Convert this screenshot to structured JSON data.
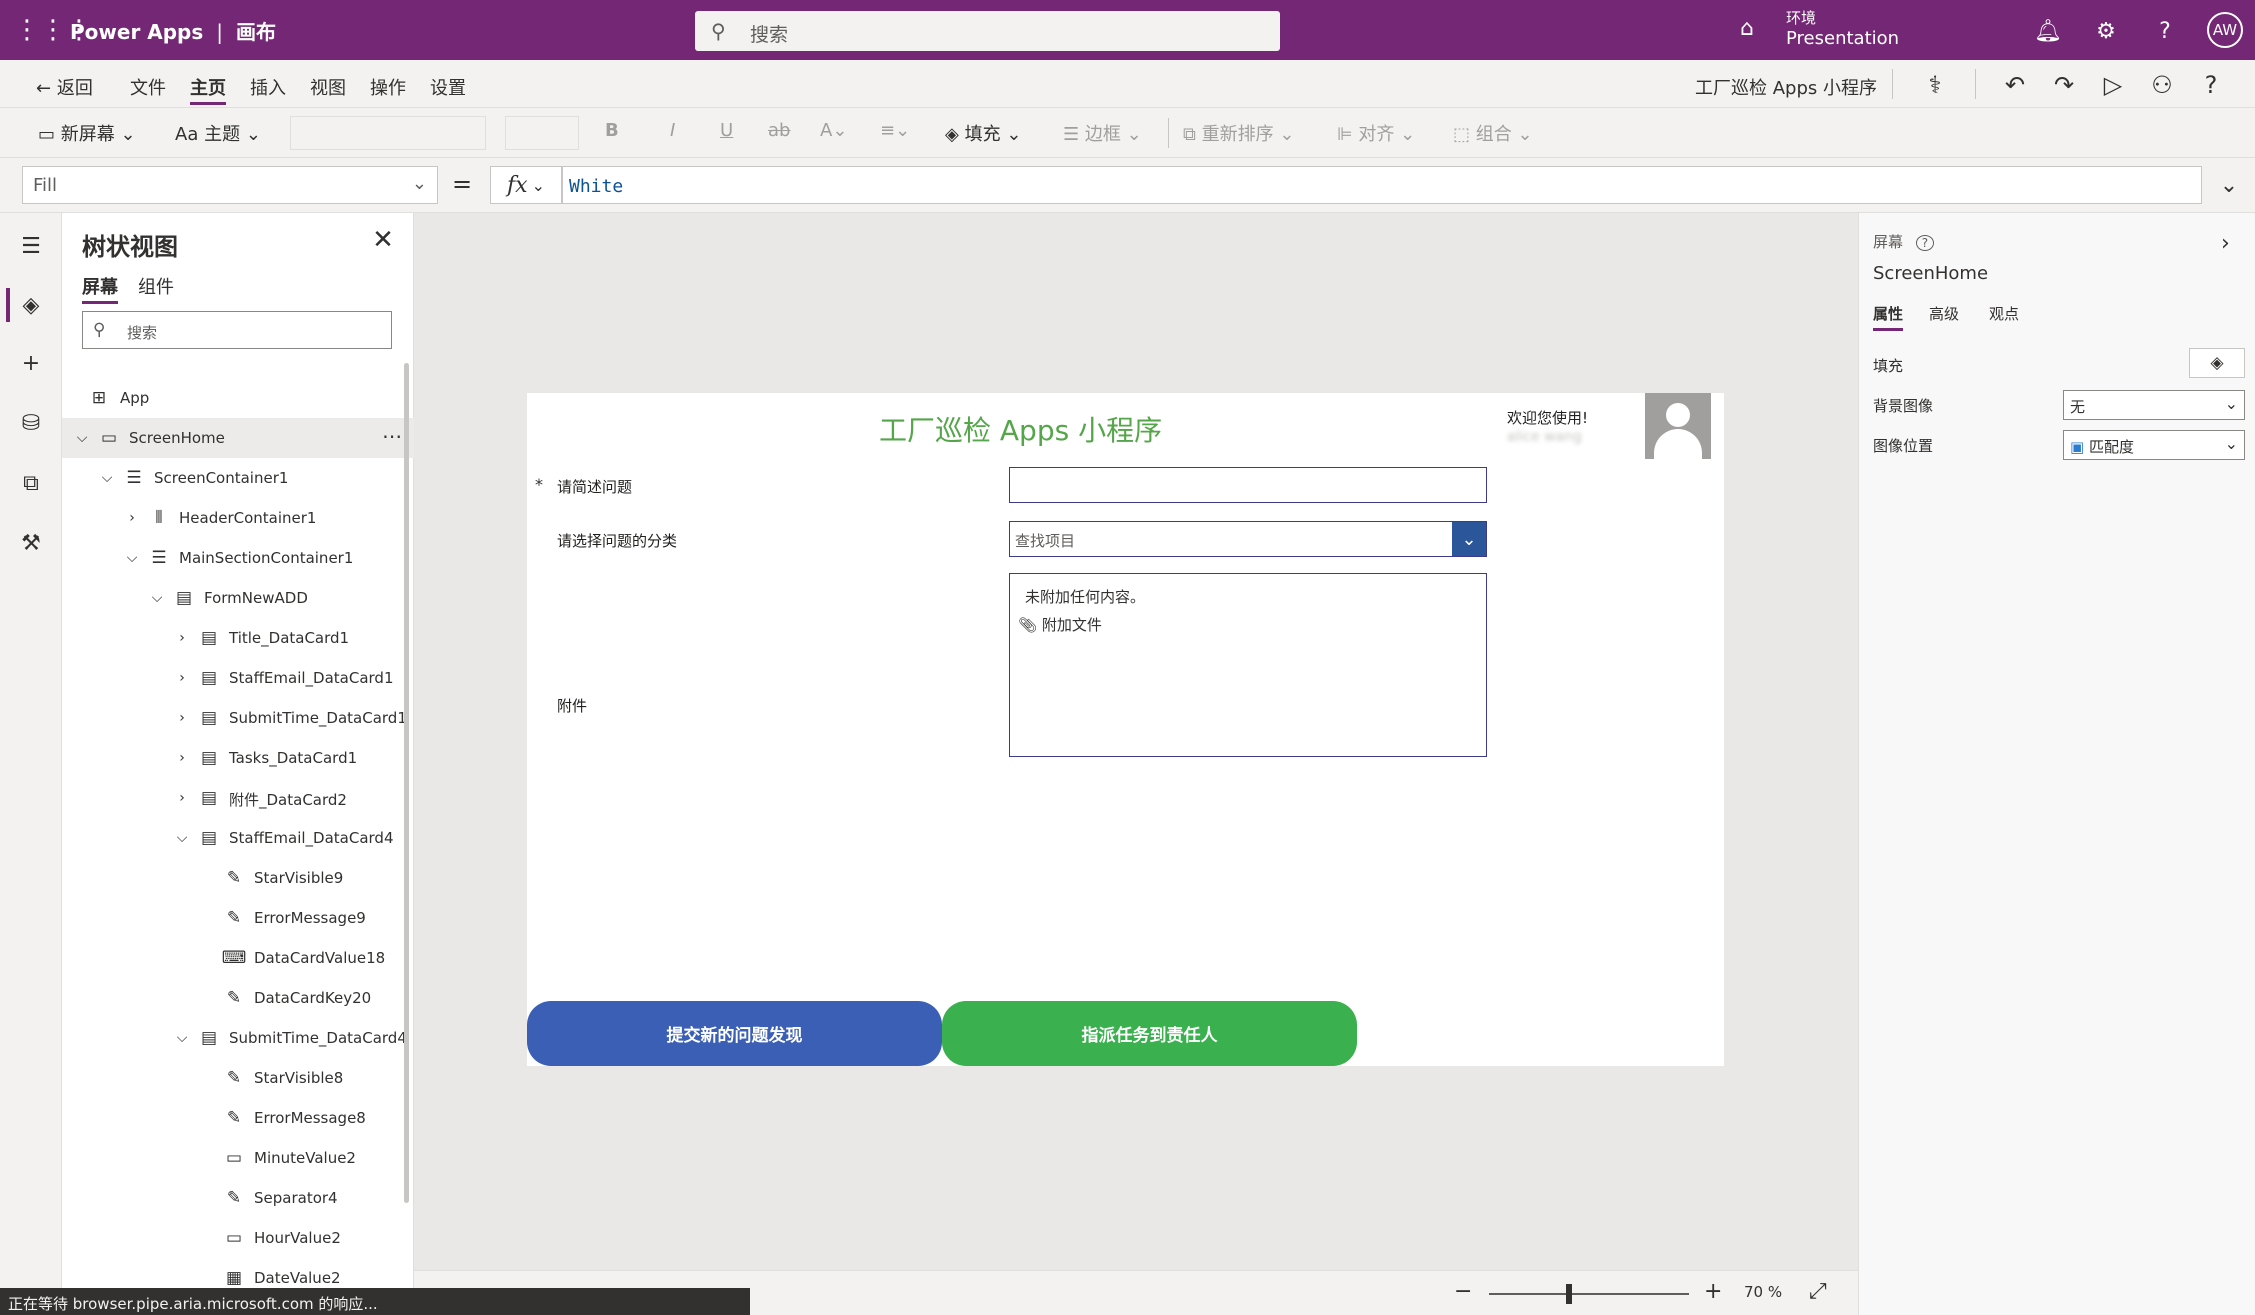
{
  "topbar": {
    "app_name": "Power Apps",
    "separator": "|",
    "mode": "画布",
    "search_placeholder": "搜索",
    "env_label": "环境",
    "env_name": "Presentation",
    "avatar_initials": "AW"
  },
  "menu": {
    "back": "返回",
    "items": [
      "文件",
      "主页",
      "插入",
      "视图",
      "操作",
      "设置"
    ],
    "active": "主页",
    "app_title": "工厂巡检 Apps 小程序"
  },
  "toolbar": {
    "new_screen": "新屏幕",
    "theme": "主题",
    "fill": "填充",
    "border": "边框",
    "reorder": "重新排序",
    "align": "对齐",
    "group": "组合"
  },
  "formula": {
    "property": "Fill",
    "equals": "=",
    "fx": "fx",
    "value": "White"
  },
  "tree": {
    "title": "树状视图",
    "tabs": [
      "屏幕",
      "组件"
    ],
    "search_placeholder": "搜索",
    "items": [
      {
        "label": "App",
        "icon": "app-icon"
      },
      {
        "label": "ScreenHome",
        "icon": "screen-icon"
      },
      {
        "label": "ScreenContainer1",
        "icon": "vertical-container-icon"
      },
      {
        "label": "HeaderContainer1",
        "icon": "horizontal-container-icon"
      },
      {
        "label": "MainSectionContainer1",
        "icon": "vertical-container-icon"
      },
      {
        "label": "FormNewADD",
        "icon": "form-icon"
      },
      {
        "label": "Title_DataCard1",
        "icon": "datacard-icon"
      },
      {
        "label": "StaffEmail_DataCard1",
        "icon": "datacard-icon"
      },
      {
        "label": "SubmitTime_DataCard1",
        "icon": "datacard-icon"
      },
      {
        "label": "Tasks_DataCard1",
        "icon": "datacard-icon"
      },
      {
        "label": "附件_DataCard2",
        "icon": "datacard-icon"
      },
      {
        "label": "StaffEmail_DataCard4",
        "icon": "datacard-icon"
      },
      {
        "label": "StarVisible9",
        "icon": "label-icon"
      },
      {
        "label": "ErrorMessage9",
        "icon": "label-icon"
      },
      {
        "label": "DataCardValue18",
        "icon": "textinput-icon"
      },
      {
        "label": "DataCardKey20",
        "icon": "label-icon"
      },
      {
        "label": "SubmitTime_DataCard4",
        "icon": "datacard-icon"
      },
      {
        "label": "StarVisible8",
        "icon": "label-icon"
      },
      {
        "label": "ErrorMessage8",
        "icon": "label-icon"
      },
      {
        "label": "MinuteValue2",
        "icon": "dropdown-icon"
      },
      {
        "label": "Separator4",
        "icon": "label-icon"
      },
      {
        "label": "HourValue2",
        "icon": "dropdown-icon"
      },
      {
        "label": "DateValue2",
        "icon": "calendar-icon"
      }
    ]
  },
  "canvas": {
    "header": "工厂巡检 Apps 小程序",
    "welcome": "欢迎您使用!",
    "user_name": "alice wang",
    "field1_star": "*",
    "field1_label": "请简述问题",
    "field2_label": "请选择问题的分类",
    "field2_placeholder": "查找项目",
    "field3_label": "附件",
    "attach_none": "未附加任何内容。",
    "attach_add": "附加文件",
    "btn_submit": "提交新的问题发现",
    "btn_assign": "指派任务到责任人"
  },
  "zoom": {
    "minus": "−",
    "plus": "+",
    "value": "70 %",
    "level": 0.7
  },
  "status": {
    "text": "正在等待 browser.pipe.aria.microsoft.com 的响应..."
  },
  "props": {
    "header": "屏幕",
    "name": "ScreenHome",
    "tabs": [
      "属性",
      "高级",
      "观点"
    ],
    "fill_label": "填充",
    "bg_image_label": "背景图像",
    "bg_image_value": "无",
    "image_pos_label": "图像位置",
    "image_pos_value": "匹配度"
  },
  "colors": {
    "brand": "#742774",
    "submit_button": "#3a5fb5",
    "assign_button": "#3ab04e",
    "header_text": "#55a64a"
  }
}
